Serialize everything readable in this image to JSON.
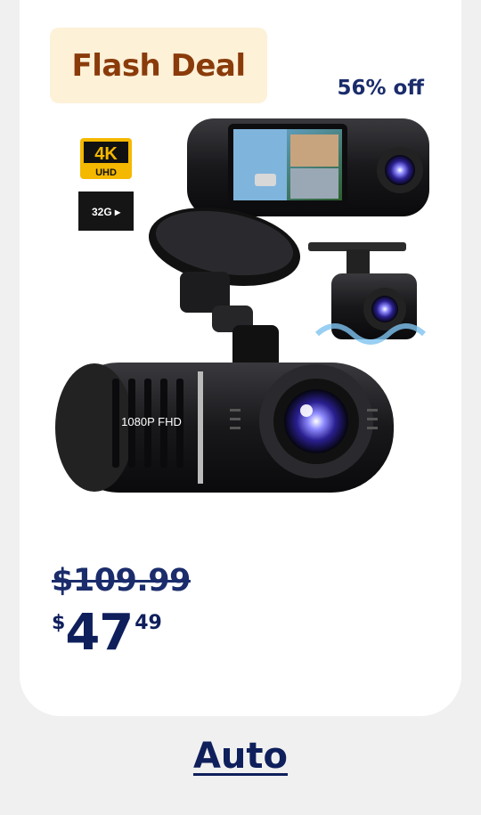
{
  "badge": {
    "label": "Flash Deal"
  },
  "discount": {
    "label": "56% off"
  },
  "product": {
    "image_labels": {
      "resolution": "4K",
      "uhd": "UHD",
      "sd_card": "32G ▸",
      "camera_text": "1080P FHD"
    }
  },
  "pricing": {
    "was_price": "$109.99",
    "currency": "$",
    "whole": "47",
    "cents": "49"
  },
  "category": {
    "label": "Auto"
  },
  "colors": {
    "badge_bg": "#fdf1d8",
    "badge_text": "#8a3b0a",
    "price_text": "#0f1f5c",
    "page_bg": "#f0f0f0",
    "card_bg": "#ffffff"
  },
  "icons": [
    "4k-uhd-icon",
    "sd-card-icon",
    "dash-camera-image"
  ]
}
